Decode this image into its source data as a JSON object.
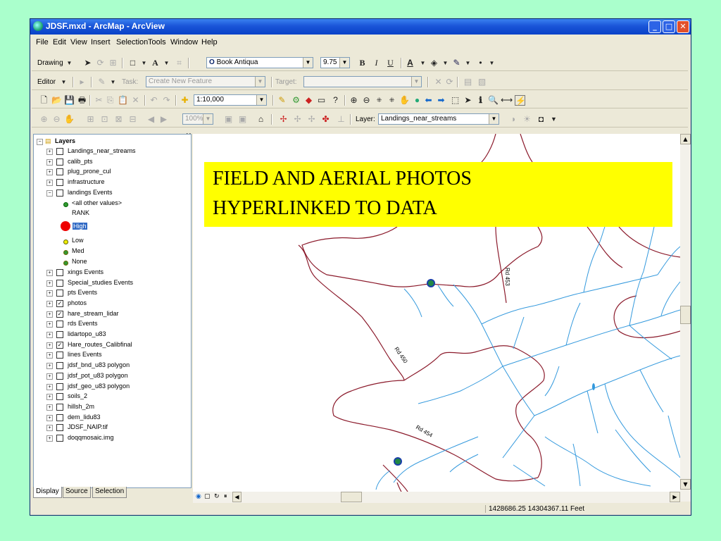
{
  "window": {
    "title": "JDSF.mxd - ArcMap - ArcView"
  },
  "menu": [
    "File",
    "Edit",
    "View",
    "Insert",
    "Selection",
    "Tools",
    "Window",
    "Help"
  ],
  "drawing_toolbar": {
    "drawing_label": "Drawing",
    "font": "Book Antiqua",
    "font_size": "9.75"
  },
  "editor_toolbar": {
    "editor_label": "Editor",
    "task_label": "Task:",
    "task_value": "Create New Feature",
    "target_label": "Target:",
    "target_value": ""
  },
  "standard_toolbar": {
    "scale": "1:10,000"
  },
  "tools_toolbar": {
    "zoom_pct": "100%",
    "layer_label": "Layer:",
    "layer_value": "Landings_near_streams"
  },
  "toc": {
    "root": "Layers",
    "layers": [
      {
        "name": "Landings_near_streams",
        "checked": false
      },
      {
        "name": "calib_pts",
        "checked": false
      },
      {
        "name": "plug_prone_cul",
        "checked": false
      },
      {
        "name": "infrastructure",
        "checked": false
      },
      {
        "name": "landings Events",
        "checked": false,
        "expanded": true
      }
    ],
    "legend": {
      "other": "<all other values>",
      "field": "RANK",
      "high": "High",
      "low": "Low",
      "med": "Med",
      "none": "None"
    },
    "layers2": [
      {
        "name": "xings Events",
        "checked": false
      },
      {
        "name": "Special_studies Events",
        "checked": false
      },
      {
        "name": "pts Events",
        "checked": false
      },
      {
        "name": "photos",
        "checked": true
      },
      {
        "name": "hare_stream_lidar",
        "checked": true
      },
      {
        "name": "rds Events",
        "checked": false
      },
      {
        "name": "lidartopo_u83",
        "checked": false
      },
      {
        "name": "Hare_routes_Calibfinal",
        "checked": true
      },
      {
        "name": "lines Events",
        "checked": false
      },
      {
        "name": "jdsf_bnd_u83 polygon",
        "checked": false
      },
      {
        "name": "jdsf_pot_u83 polygon",
        "checked": false
      },
      {
        "name": "jdsf_geo_u83 polygon",
        "checked": false
      },
      {
        "name": "soils_2",
        "checked": false
      },
      {
        "name": "hillsh_2m",
        "checked": false
      },
      {
        "name": "dem_lidu83",
        "checked": false
      },
      {
        "name": "JDSF_NAIP.tif",
        "checked": false
      },
      {
        "name": "doqqmosaic.img",
        "checked": false
      }
    ],
    "tabs": [
      "Display",
      "Source",
      "Selection"
    ]
  },
  "map": {
    "banner_line1": "FIELD AND AERIAL PHOTOS",
    "banner_line2": "HYPERLINKED TO DATA",
    "road_labels": [
      "Rd 453",
      "Rd 450",
      "Rd 454"
    ]
  },
  "status": {
    "coords": "1428686.25  14304367.11 Feet"
  },
  "colors": {
    "background": "#aaffcc",
    "banner": "#ffff00",
    "streams": "#3399dd",
    "roads": "#8b1a2b"
  }
}
